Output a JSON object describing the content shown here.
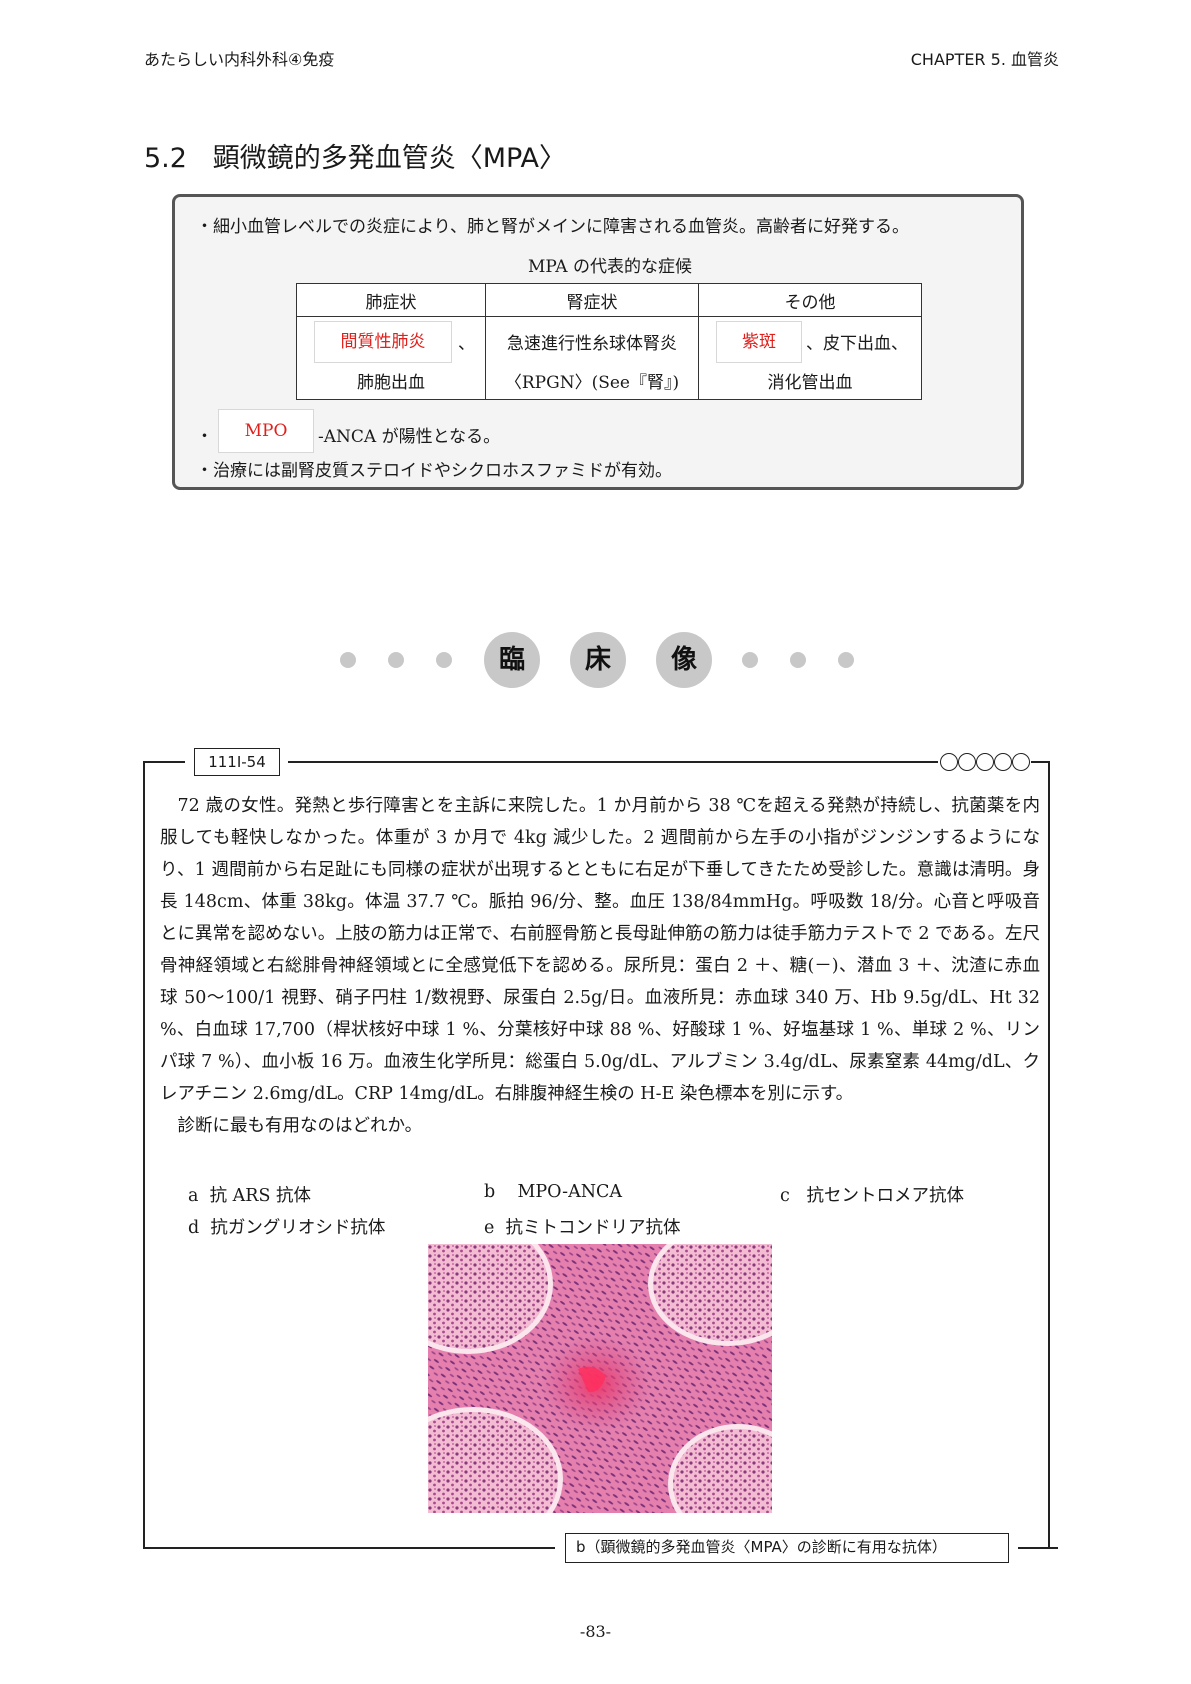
{
  "header": {
    "book": "あたらしい内科外科④免疫",
    "chapter": "CHAPTER  5.  血管炎"
  },
  "section": {
    "number": "5.2",
    "title": "顕微鏡的多発血管炎〈MPA〉"
  },
  "summary": {
    "line1": "・細小血管レベルでの炎症により、肺と腎がメインに障害される血管炎。高齢者に好発する。",
    "table_caption": "MPA の代表的な症候",
    "table": {
      "headers": [
        "肺症状",
        "腎症状",
        "その他"
      ],
      "lung": {
        "blank": "間質性肺炎",
        "after": "、",
        "line2": "肺胞出血"
      },
      "kidney": {
        "line1": "急速進行性糸球体腎炎",
        "line2": "〈RPGN〉(See『腎』)"
      },
      "other": {
        "blank": "紫斑",
        "after": "、皮下出血、",
        "line2": "消化管出血"
      }
    },
    "line2_bullet": "・",
    "line2_blank": "MPO",
    "line2_rest": "-ANCA が陽性となる。",
    "line3": "・治療には副腎皮質ステロイドやシクロホスファミドが有効。"
  },
  "clinical_heading": {
    "chars": [
      "臨",
      "床",
      "像"
    ]
  },
  "question": {
    "id": "111I-54",
    "circles": 5,
    "paragraph": "72 歳の女性。発熱と歩行障害とを主訴に来院した。1 か月前から 38 ℃を超える発熱が持続し、抗菌薬を内服しても軽快しなかった。体重が 3 か月で 4kg 減少した。2 週間前から左手の小指がジンジンするようになり、1 週間前から右足趾にも同様の症状が出現するとともに右足が下垂してきたため受診した。意識は清明。身長 148cm、体重 38kg。体温 37.7 ℃。脈拍 96/分、整。血圧 138/84mmHg。呼吸数 18/分。心音と呼吸音とに異常を認めない。上肢の筋力は正常で、右前脛骨筋と長母趾伸筋の筋力は徒手筋力テストで 2 である。左尺骨神経領域と右総腓骨神経領域とに全感覚低下を認める。尿所見：蛋白 2 ＋、糖(－)、潜血 3 ＋、沈渣に赤血球 50〜100/1 視野、硝子円柱 1/数視野、尿蛋白 2.5g/日。血液所見：赤血球 340 万、Hb 9.5g/dL、Ht 32 %、白血球 17,700（桿状核好中球 1 %、分葉核好中球 88 %、好酸球 1 %、好塩基球 1 %、単球 2 %、リンパ球 7 %）、血小板 16 万。血液生化学所見：総蛋白 5.0g/dL、アルブミン 3.4g/dL、尿素窒素 44mg/dL、クレアチニン 2.6mg/dL。CRP 14mg/dL。右腓腹神経生検の H-E 染色標本を別に示す。",
    "prompt": "診断に最も有用なのはどれか。",
    "choices": [
      {
        "key": "a",
        "text": "抗 ARS 抗体"
      },
      {
        "key": "b",
        "text": "MPO-ANCA"
      },
      {
        "key": "c",
        "text": "抗セントロメア抗体"
      },
      {
        "key": "d",
        "text": "抗ガングリオシド抗体"
      },
      {
        "key": "e",
        "text": "抗ミトコンドリア抗体"
      }
    ],
    "answer": "b（顕微鏡的多発血管炎〈MPA〉の診断に有用な抗体）"
  },
  "page_number": "-83-",
  "colors": {
    "accent_red": "#e0201c",
    "box_bg": "#f4f4f4",
    "dot_grey": "#c8c8c8",
    "stain_pink": "#d9609a"
  }
}
